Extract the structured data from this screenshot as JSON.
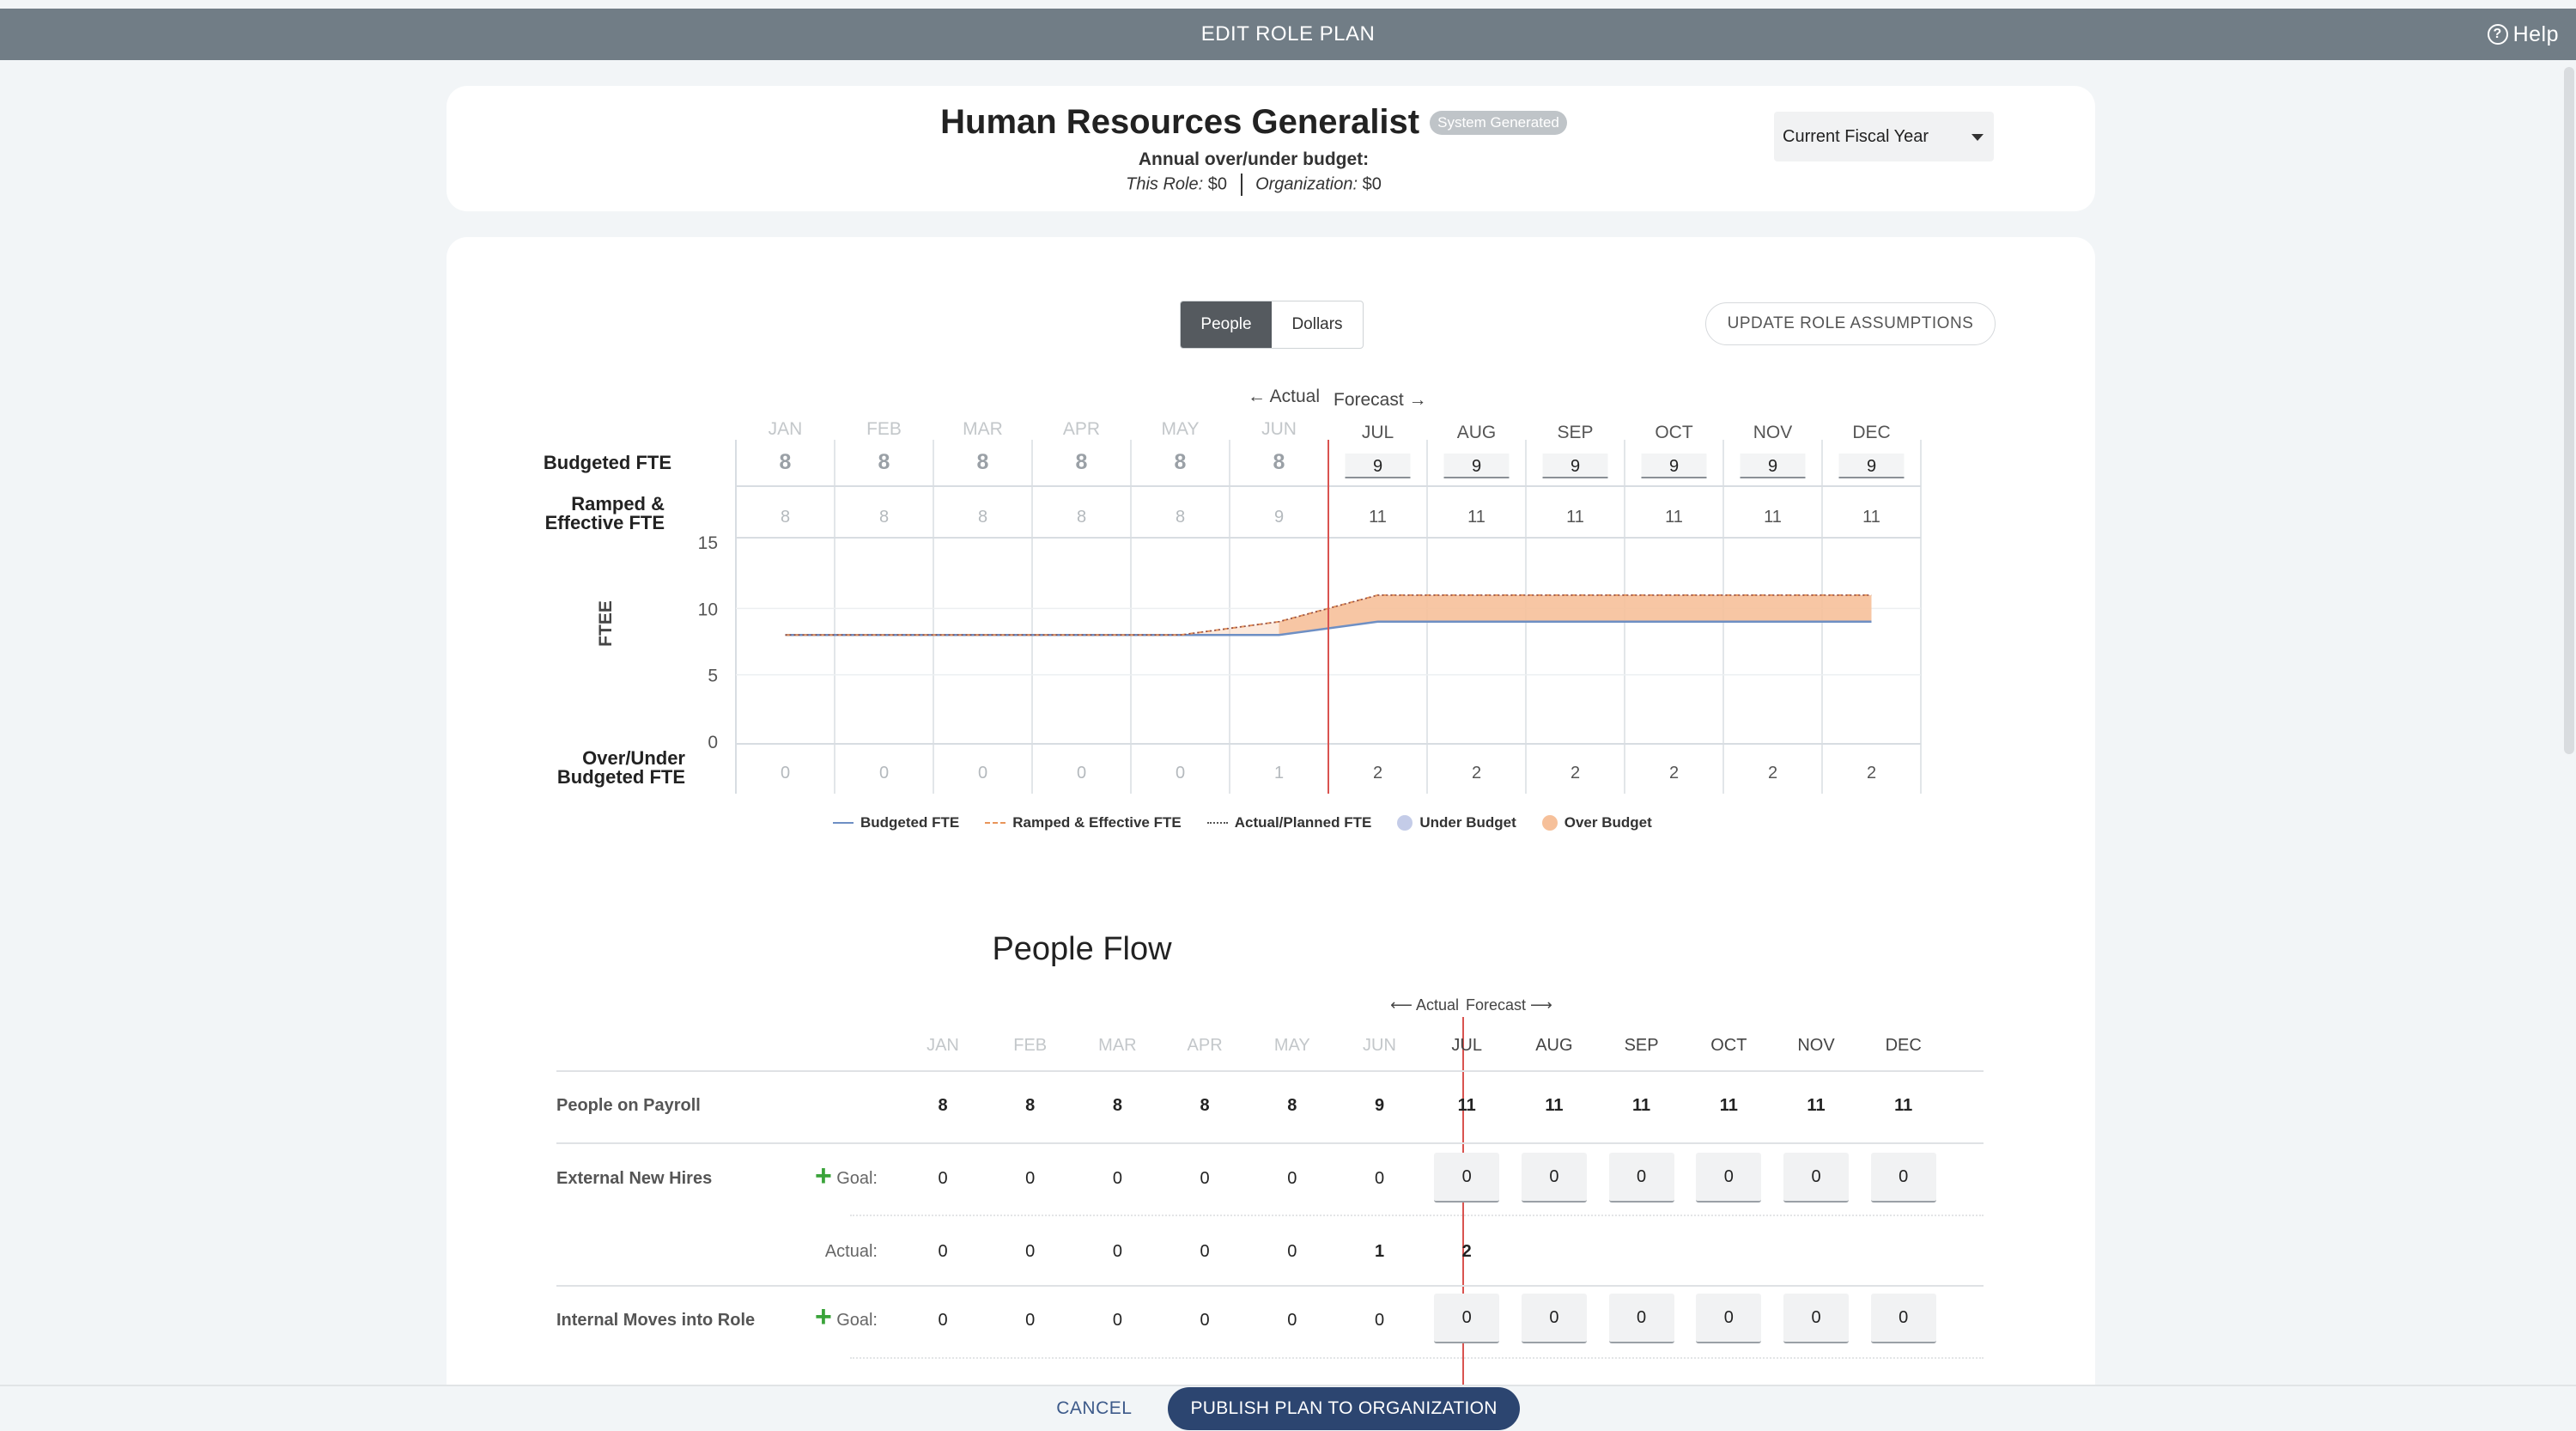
{
  "topbar": {
    "title": "EDIT ROLE PLAN",
    "help": "Help"
  },
  "header": {
    "role_title": "Human Resources Generalist",
    "badge": "System Generated",
    "budget_label": "Annual over/under budget:",
    "this_role_label": "This Role:",
    "this_role_value": "$0",
    "org_label": "Organization:",
    "org_value": "$0",
    "fiscal_year": "Current Fiscal Year"
  },
  "toggle": {
    "people": "People",
    "dollars": "Dollars",
    "active": "people"
  },
  "update_button": "UPDATE ROLE ASSUMPTIONS",
  "months": [
    "JAN",
    "FEB",
    "MAR",
    "APR",
    "MAY",
    "JUN",
    "JUL",
    "AUG",
    "SEP",
    "OCT",
    "NOV",
    "DEC"
  ],
  "actual_months": 6,
  "chart": {
    "actual_label": "← Actual",
    "forecast_label": "Forecast →",
    "row_labels": {
      "budgeted": "Budgeted FTE",
      "ramped_1": "Ramped &",
      "ramped_2": "Effective FTE",
      "over_1": "Over/Under",
      "over_2": "Budgeted FTE"
    },
    "y_axis_label": "FTEE",
    "y_ticks": [
      0,
      5,
      10,
      15
    ]
  },
  "chart_data": {
    "type": "area",
    "categories": [
      "JAN",
      "FEB",
      "MAR",
      "APR",
      "MAY",
      "JUN",
      "JUL",
      "AUG",
      "SEP",
      "OCT",
      "NOV",
      "DEC"
    ],
    "series": [
      {
        "name": "Budgeted FTE",
        "values": [
          8,
          8,
          8,
          8,
          8,
          8,
          9,
          9,
          9,
          9,
          9,
          9
        ]
      },
      {
        "name": "Ramped & Effective FTE",
        "values": [
          8,
          8,
          8,
          8,
          8,
          9,
          11,
          11,
          11,
          11,
          11,
          11
        ]
      },
      {
        "name": "Over/Under Budgeted FTE",
        "values": [
          0,
          0,
          0,
          0,
          0,
          1,
          2,
          2,
          2,
          2,
          2,
          2
        ]
      }
    ],
    "ylabel": "FTEE",
    "ylim": [
      0,
      15
    ],
    "legend": [
      "Budgeted FTE",
      "Ramped & Effective FTE",
      "Actual/Planned FTE",
      "Under Budget",
      "Over Budget"
    ],
    "legend_placement": "bottom",
    "colors": {
      "budgeted": "#6e8fc4",
      "ramped": "#e8955a",
      "under": "#c4cce8",
      "over": "#f6c09a",
      "divider": "#d9534f"
    }
  },
  "people_flow": {
    "title": "People Flow",
    "actual_label": "Actual",
    "forecast_label": "Forecast",
    "rows": {
      "payroll": {
        "label": "People on Payroll",
        "values": [
          "8",
          "8",
          "8",
          "8",
          "8",
          "9",
          "11",
          "11",
          "11",
          "11",
          "11",
          "11"
        ]
      },
      "external": {
        "label": "External New Hires",
        "goal_label": "Goal:",
        "goal": [
          "0",
          "0",
          "0",
          "0",
          "0",
          "0",
          "0",
          "0",
          "0",
          "0",
          "0",
          "0"
        ],
        "actual_label": "Actual:",
        "actual": [
          "0",
          "0",
          "0",
          "0",
          "0",
          "1",
          "2"
        ]
      },
      "internal": {
        "label": "Internal Moves into Role",
        "goal_label": "Goal:",
        "goal": [
          "0",
          "0",
          "0",
          "0",
          "0",
          "0",
          "0",
          "0",
          "0",
          "0",
          "0",
          "0"
        ]
      }
    }
  },
  "footer": {
    "cancel": "CANCEL",
    "publish": "PUBLISH PLAN TO ORGANIZATION"
  }
}
